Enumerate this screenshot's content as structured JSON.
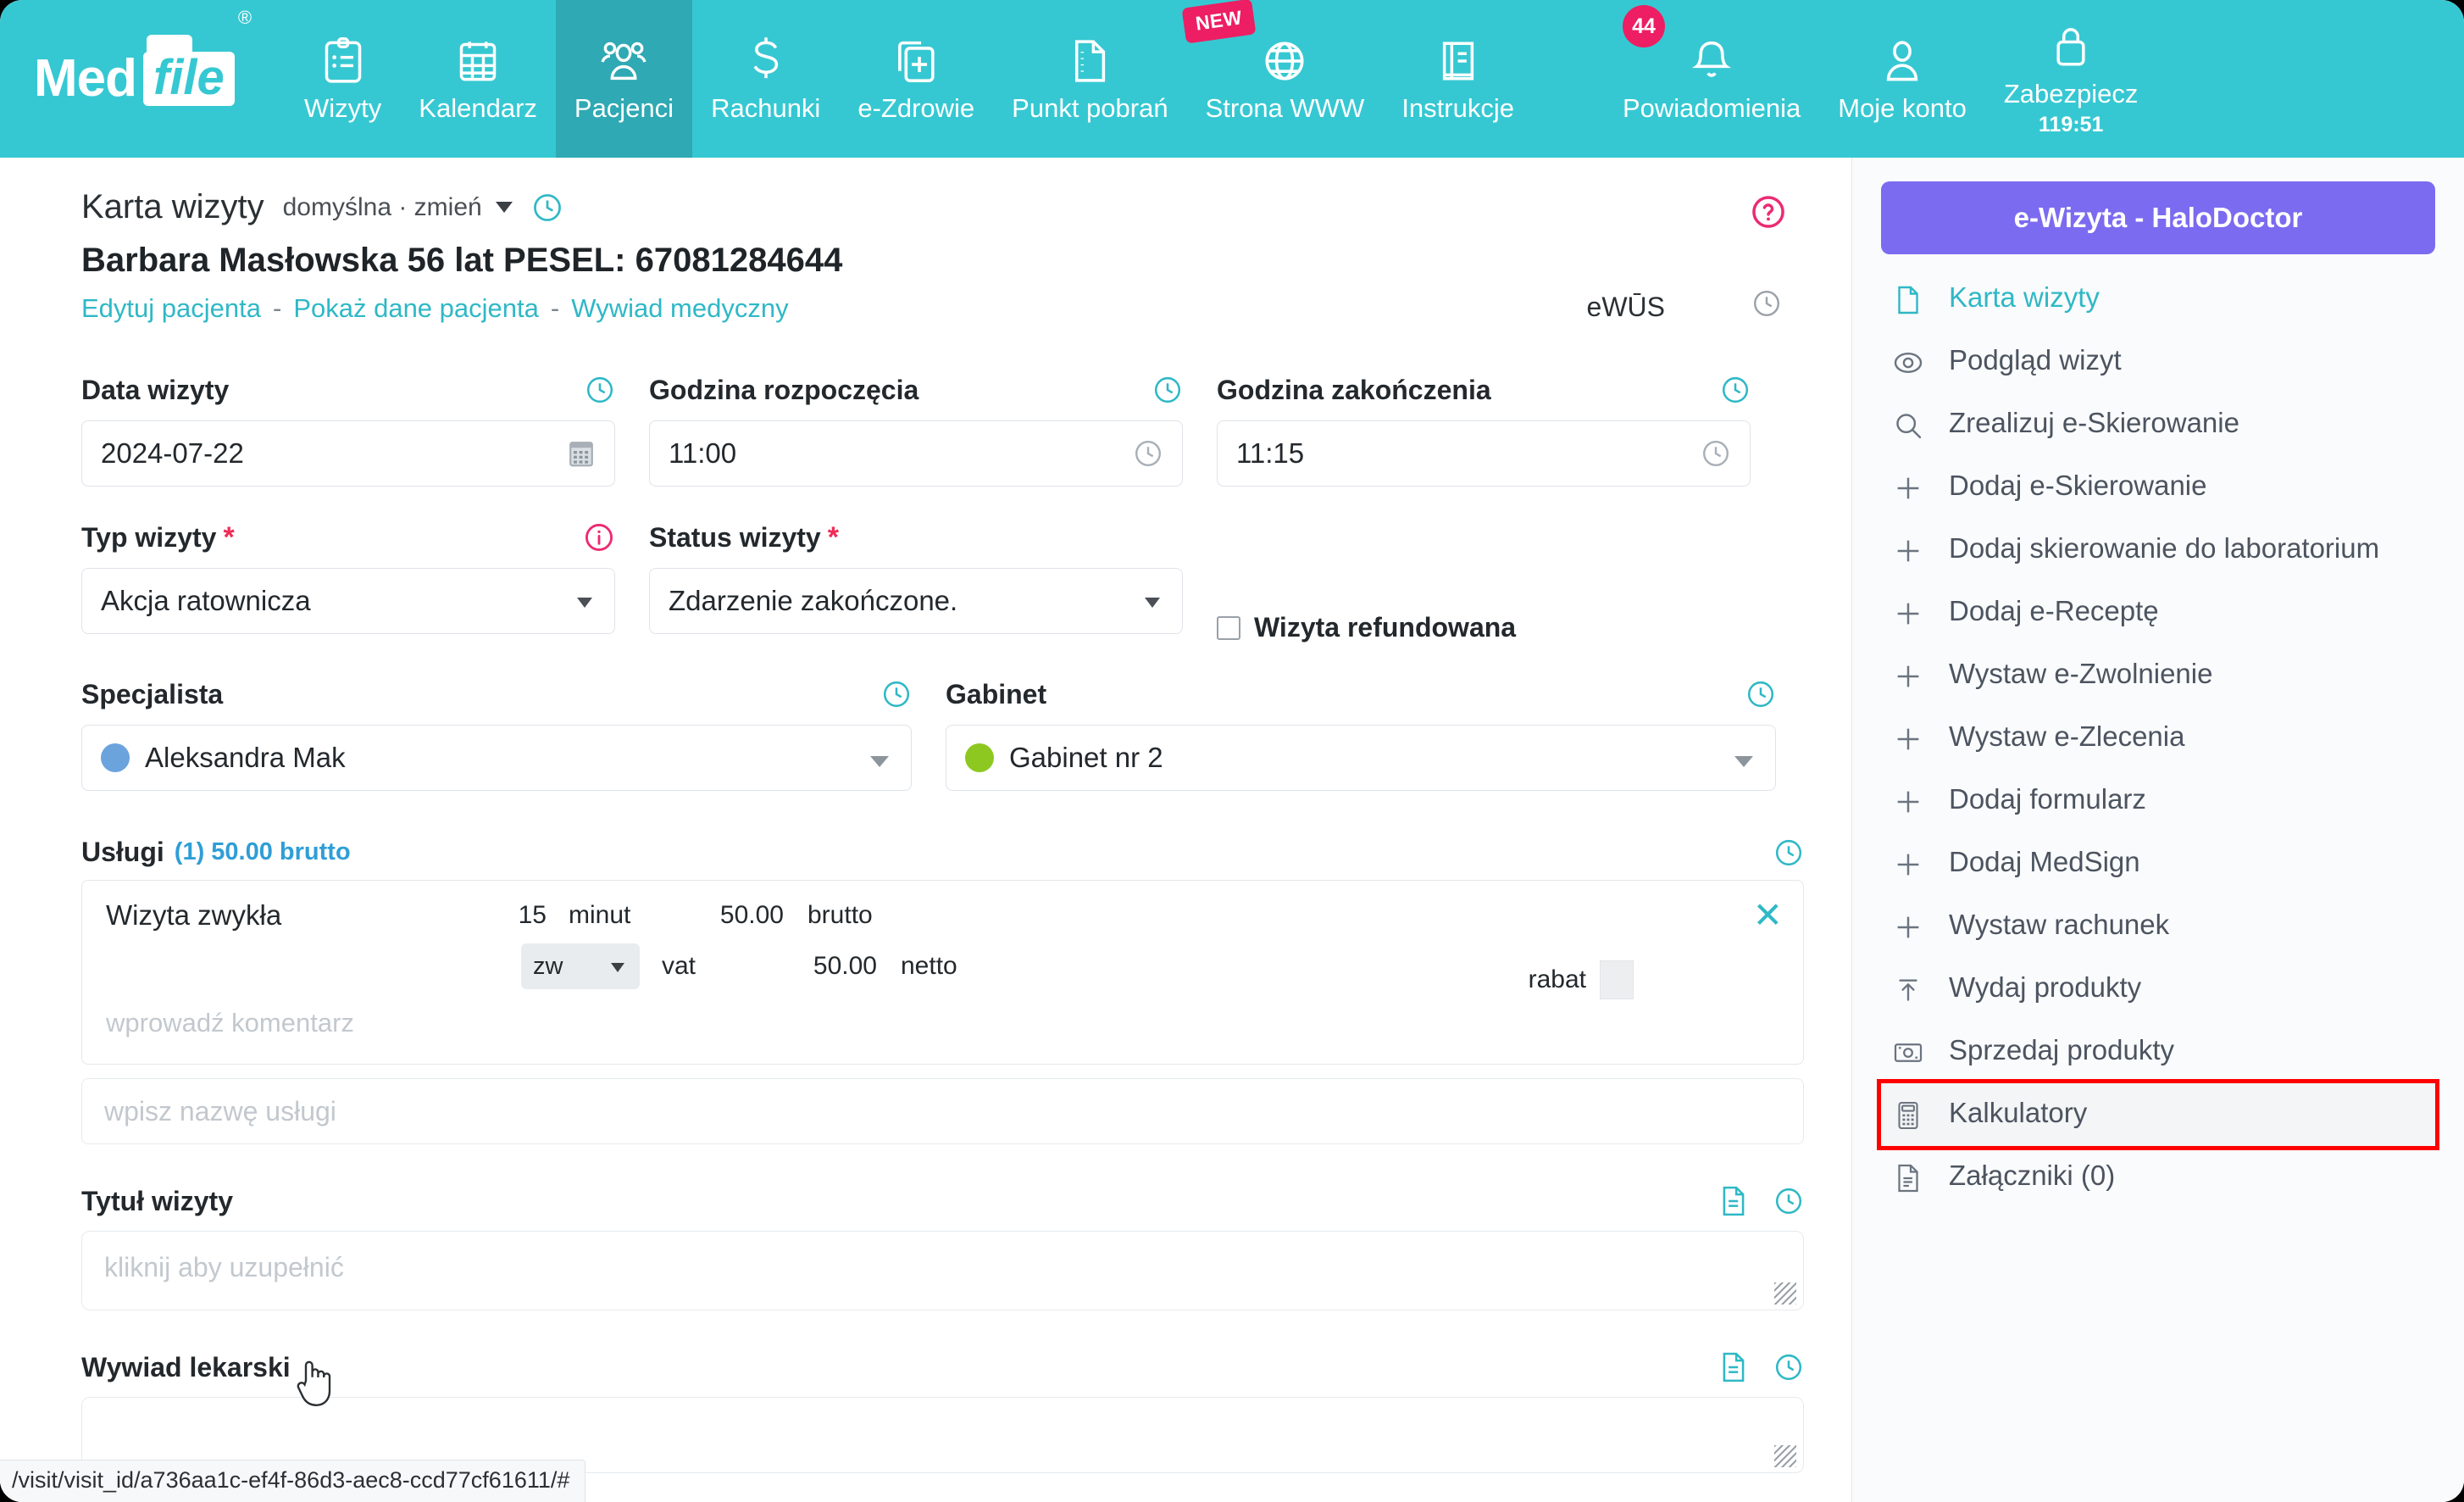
{
  "brand": {
    "name_part1": "Med",
    "name_part2": "file",
    "registered": "®"
  },
  "topnav": {
    "items": [
      {
        "label": "Wizyty",
        "icon": "clipboard-icon",
        "active": false
      },
      {
        "label": "Kalendarz",
        "icon": "calendar-icon",
        "active": false
      },
      {
        "label": "Pacjenci",
        "icon": "patients-icon",
        "active": true
      },
      {
        "label": "Rachunki",
        "icon": "dollar-icon",
        "active": false
      },
      {
        "label": "e-Zdrowie",
        "icon": "health-card-icon",
        "active": false
      },
      {
        "label": "Punkt pobrań",
        "icon": "document-icon",
        "active": false
      },
      {
        "label": "Strona WWW",
        "icon": "globe-icon",
        "active": false,
        "badge": "NEW"
      },
      {
        "label": "Instrukcje",
        "icon": "book-icon",
        "active": false
      }
    ],
    "right_items": [
      {
        "label": "Powiadomienia",
        "icon": "bell-icon",
        "count": "44"
      },
      {
        "label": "Moje konto",
        "icon": "user-icon"
      },
      {
        "label": "Zabezpiecz",
        "icon": "lock-icon",
        "sub": "119:51"
      }
    ],
    "accent_color": "#36c8d2",
    "active_color": "#2fa9b3",
    "badge_color": "#ed1e63"
  },
  "card": {
    "title": "Karta wizyty",
    "profile": "domyślna · zmień",
    "patient": "Barbara Masłowska 56 lat PESEL: 67081284644",
    "links": [
      "Edytuj pacjenta",
      "Pokaż dane pacjenta",
      "Wywiad medyczny"
    ],
    "link_separator": "-",
    "ewus_label": "eWŪS",
    "help_icon": "question-mark-icon"
  },
  "form": {
    "date": {
      "label": "Data wizyty",
      "value": "2024-07-22",
      "icon": "calendar-icon"
    },
    "start_time": {
      "label": "Godzina rozpoczęcia",
      "value": "11:00",
      "icon": "clock-icon"
    },
    "end_time": {
      "label": "Godzina zakończenia",
      "value": "11:15",
      "icon": "clock-icon"
    },
    "visit_type": {
      "label": "Typ wizyty",
      "required": "*",
      "value": "Akcja ratownicza",
      "info_icon": "info-icon"
    },
    "visit_status": {
      "label": "Status wizyty",
      "required": "*",
      "value": "Zdarzenie zakończone."
    },
    "refunded": {
      "label": "Wizyta refundowana",
      "checked": false
    },
    "specialist": {
      "label": "Specjalista",
      "value": "Aleksandra Mak",
      "dot_color": "#6ba3dd"
    },
    "room": {
      "label": "Gabinet",
      "value": "Gabinet nr 2",
      "dot_color": "#8dc820"
    }
  },
  "services": {
    "label": "Usługi",
    "summary": "(1) 50.00 brutto",
    "row": {
      "name": "Wizyta zwykła",
      "duration": "15",
      "duration_unit": "minut",
      "gross_value": "50.00",
      "gross_label": "brutto",
      "vat_rate": "zw",
      "vat_label": "vat",
      "net_value": "50.00",
      "net_label": "netto",
      "discount_label": "rabat",
      "comment_placeholder": "wprowadź komentarz",
      "close_icon": "close-icon"
    },
    "add_placeholder": "wpisz nazwę usługi"
  },
  "visit_title": {
    "label": "Tytuł wizyty",
    "placeholder": "kliknij aby uzupełnić"
  },
  "interview": {
    "label": "Wywiad lekarski",
    "placeholder": ""
  },
  "statusbar": {
    "url": "/visit/visit_id/a736aa1c-ef4f-86d3-aec8-ccd77cf61611/#"
  },
  "sidebar": {
    "button": {
      "label": "e-Wizyta - HaloDoctor",
      "color": "#7b6bf0"
    },
    "items": [
      {
        "label": "Karta wizyty",
        "icon": "file-icon",
        "state": "active"
      },
      {
        "label": "Podgląd wizyt",
        "icon": "eye-icon",
        "state": "normal"
      },
      {
        "label": "Zrealizuj e-Skierowanie",
        "icon": "search-icon",
        "state": "normal"
      },
      {
        "label": "Dodaj e-Skierowanie",
        "icon": "plus-icon",
        "state": "normal"
      },
      {
        "label": "Dodaj skierowanie do laboratorium",
        "icon": "plus-icon",
        "state": "normal"
      },
      {
        "label": "Dodaj e-Receptę",
        "icon": "plus-icon",
        "state": "normal"
      },
      {
        "label": "Wystaw e-Zwolnienie",
        "icon": "plus-icon",
        "state": "normal"
      },
      {
        "label": "Wystaw e-Zlecenia",
        "icon": "plus-icon",
        "state": "normal"
      },
      {
        "label": "Dodaj formularz",
        "icon": "plus-icon",
        "state": "normal"
      },
      {
        "label": "Dodaj MedSign",
        "icon": "plus-icon",
        "state": "normal"
      },
      {
        "label": "Wystaw rachunek",
        "icon": "plus-icon",
        "state": "normal"
      },
      {
        "label": "Wydaj produkty",
        "icon": "upload-icon",
        "state": "normal"
      },
      {
        "label": "Sprzedaj produkty",
        "icon": "money-icon",
        "state": "normal"
      },
      {
        "label": "Kalkulatory",
        "icon": "calculator-icon",
        "state": "highlighted"
      },
      {
        "label": "Załączniki (0)",
        "icon": "attachment-icon",
        "state": "normal"
      }
    ],
    "highlight_color": "#ff0000"
  }
}
